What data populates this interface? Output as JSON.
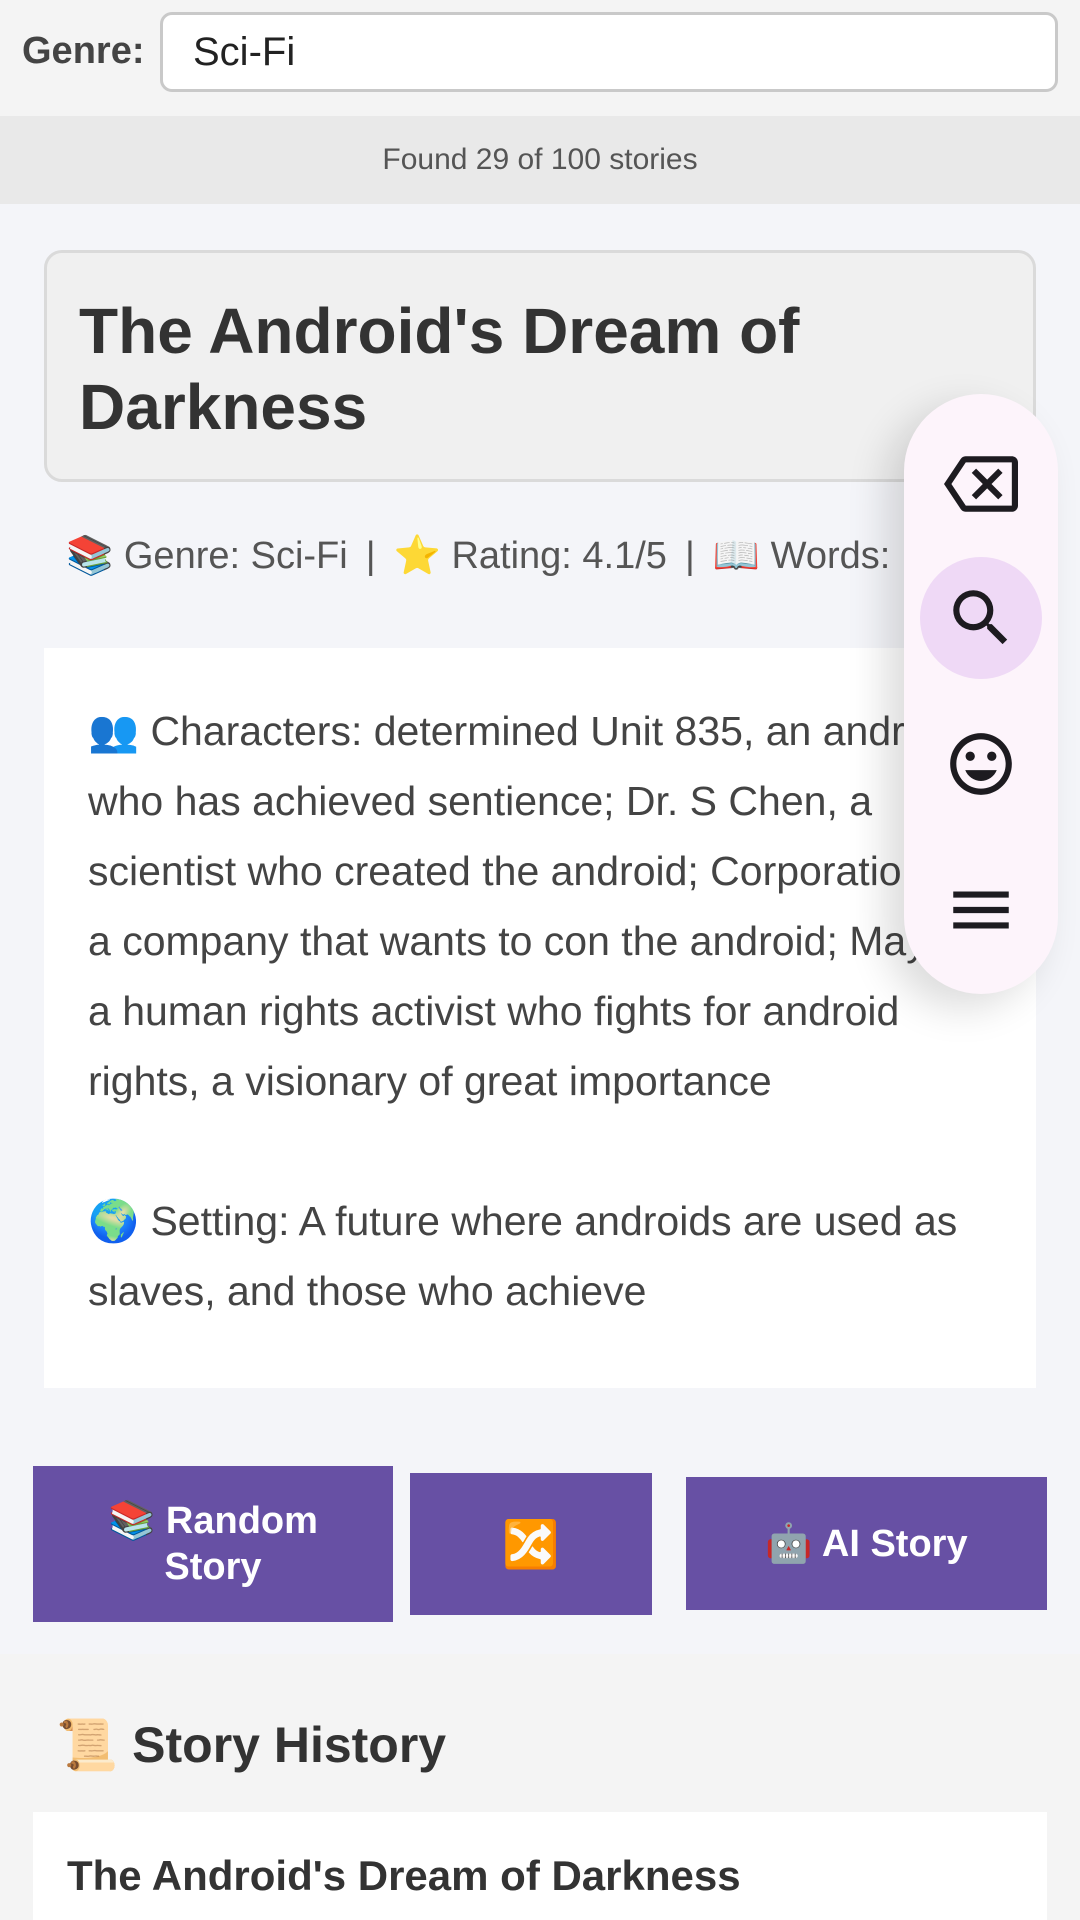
{
  "filter": {
    "label": "Genre:",
    "value": "Sci-Fi",
    "placeholder": ""
  },
  "results": {
    "text": "Found 29 of 100 stories"
  },
  "story": {
    "title": "The Android's Dream of Darkness",
    "meta": {
      "genre": "📚 Genre: Sci-Fi",
      "rating": "⭐ Rating: 4.1/5",
      "words": "📖 Words:",
      "separator": "|"
    },
    "characters": "👥 Characters: determined Unit 835, an android who has achieved sentience; Dr. S Chen, a scientist who created the android; Corporation, a company that wants to con the android; Maya, a human rights activist who fights for android rights, a visionary of great importance",
    "setting": "🌍 Setting: A future where androids are used as slaves, and those who achieve"
  },
  "fab": {
    "icons": [
      "backspace-icon",
      "search-icon",
      "emoji-icon",
      "menu-icon"
    ],
    "active": "search-icon"
  },
  "buttons": {
    "random": "📚 Random Story",
    "shuffle": "🔀",
    "ai": "🤖 AI Story",
    "color": "#6750a4"
  },
  "history": {
    "heading": "📜 Story History",
    "items": [
      {
        "title": "The Android's Dream of Darkness"
      }
    ]
  }
}
